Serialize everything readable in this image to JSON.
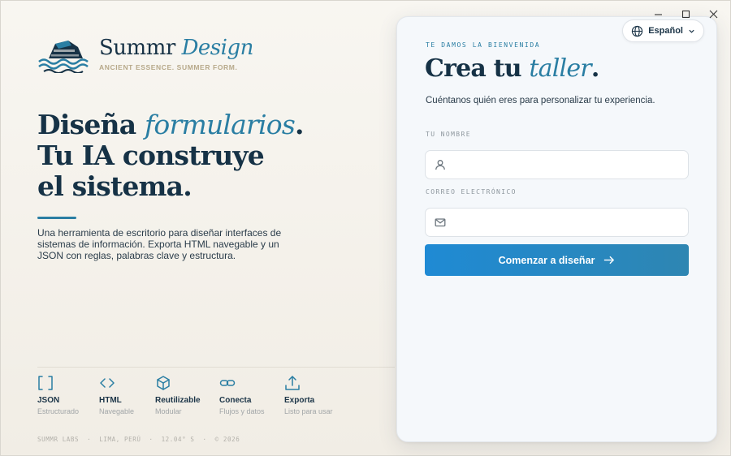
{
  "brand": {
    "name_plain": "Summr",
    "name_accent": "Design",
    "tagline": "ANCIENT ESSENCE. SUMMER FORM."
  },
  "hero": {
    "line1_plain": "Diseña",
    "line1_accent": "formularios",
    "line1_end": ".",
    "line2": "Tu IA construye",
    "line3": "el sistema.",
    "description": "Una herramienta de escritorio para diseñar interfaces de sistemas de información. Exporta HTML navegable y un JSON con reglas, palabras clave y estructura."
  },
  "features": [
    {
      "icon": "brackets-icon",
      "title": "JSON",
      "subtitle": "Estructurado"
    },
    {
      "icon": "code-icon",
      "title": "HTML",
      "subtitle": "Navegable"
    },
    {
      "icon": "cube-icon",
      "title": "Reutilizable",
      "subtitle": "Modular"
    },
    {
      "icon": "link-icon",
      "title": "Conecta",
      "subtitle": "Flujos y datos"
    },
    {
      "icon": "upload-icon",
      "title": "Exporta",
      "subtitle": "Listo para usar"
    }
  ],
  "footer": {
    "company": "SUMMR LABS",
    "sep": "·",
    "city": "LIMA, PERÚ",
    "coords": "12.04° S",
    "year": "© 2026"
  },
  "language": {
    "selected": "Español"
  },
  "card": {
    "eyebrow": "TE DAMOS LA BIENVENIDA",
    "title_plain": "Crea tu",
    "title_accent": "taller",
    "title_end": ".",
    "subtitle": "Cuéntanos quién eres para personalizar tu experiencia.",
    "name_label": "TU NOMBRE",
    "name_value": "",
    "email_label": "CORREO ELECTRÓNICO",
    "email_value": "",
    "cta_label": "Comenzar a diseñar"
  },
  "colors": {
    "accent": "#2a7ea3",
    "ink": "#163246",
    "cta_start": "#1f8ad4",
    "cta_end": "#2e86b2",
    "background": "#f5f2ec"
  }
}
